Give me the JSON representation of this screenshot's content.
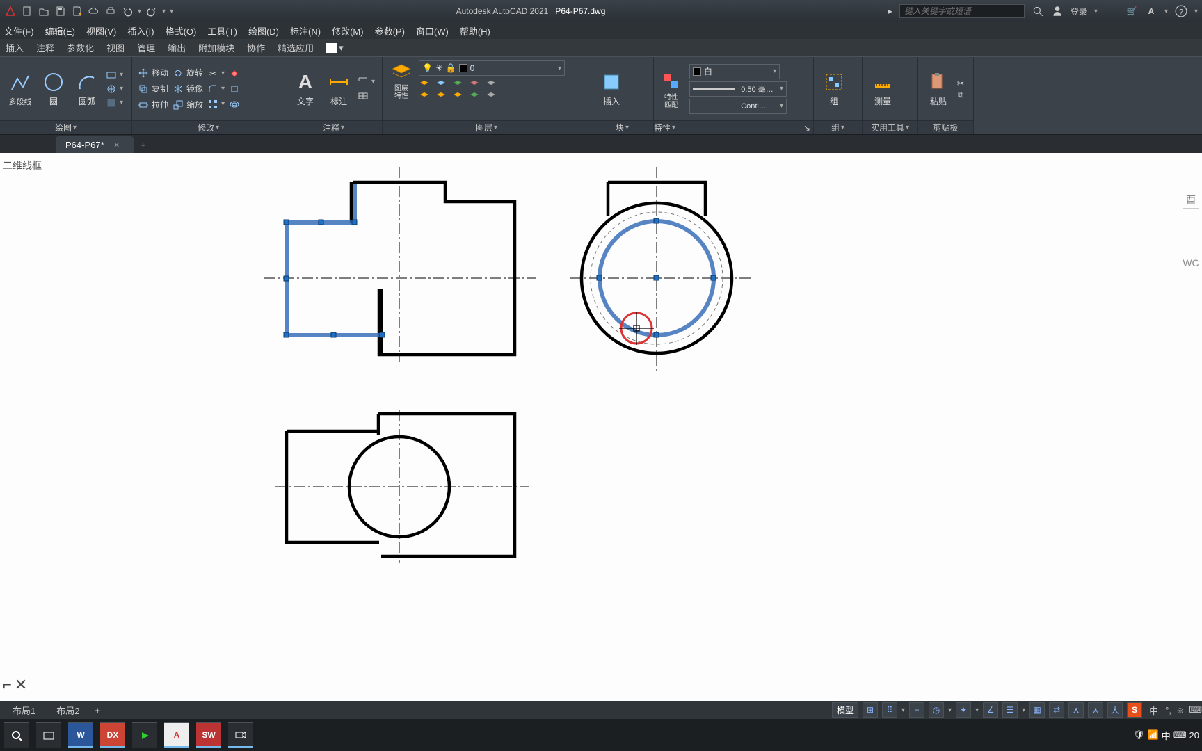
{
  "app": {
    "name": "Autodesk AutoCAD 2021",
    "file": "P64-P67.dwg"
  },
  "search_placeholder": "键入关键字或短语",
  "login": "登录",
  "menus": [
    "文件(F)",
    "编辑(E)",
    "视图(V)",
    "插入(I)",
    "格式(O)",
    "工具(T)",
    "绘图(D)",
    "标注(N)",
    "修改(M)",
    "参数(P)",
    "窗口(W)",
    "帮助(H)"
  ],
  "tabs": [
    "插入",
    "注释",
    "参数化",
    "视图",
    "管理",
    "输出",
    "附加模块",
    "协作",
    "精选应用"
  ],
  "ribbon": {
    "draw": {
      "title": "绘图",
      "polyline": "多段线",
      "circle": "圆",
      "arc": "圆弧"
    },
    "modify": {
      "title": "修改",
      "move": "移动",
      "rotate": "旋转",
      "copy": "复制",
      "mirror": "镜像",
      "stretch": "拉伸",
      "scale": "缩放"
    },
    "annot": {
      "title": "注释",
      "text": "文字",
      "dim": "标注"
    },
    "layers": {
      "title": "图层",
      "props": "图层\n特性",
      "current": "0"
    },
    "block": {
      "title": "块",
      "insert": "插入"
    },
    "props": {
      "title": "特性",
      "match": "特性\n匹配",
      "color": "白",
      "lw": "0.50 毫…",
      "lt": "Conti…"
    },
    "group": {
      "title": "组",
      "g": "组"
    },
    "util": {
      "title": "实用工具",
      "measure": "测量"
    },
    "clip": {
      "title": "剪贴板",
      "paste": "粘贴"
    }
  },
  "doctab": "P64-P67*",
  "viewstyle": "二维线框",
  "right_labels": {
    "a": "酉",
    "b": "WC"
  },
  "layouts": {
    "l1": "布局1",
    "l2": "布局2",
    "model": "模型"
  },
  "taskbar": {
    "dx": "DX",
    "sw": "SW",
    "a": "A",
    "w": "W"
  },
  "ime": {
    "cn": "中",
    "date": "20"
  }
}
